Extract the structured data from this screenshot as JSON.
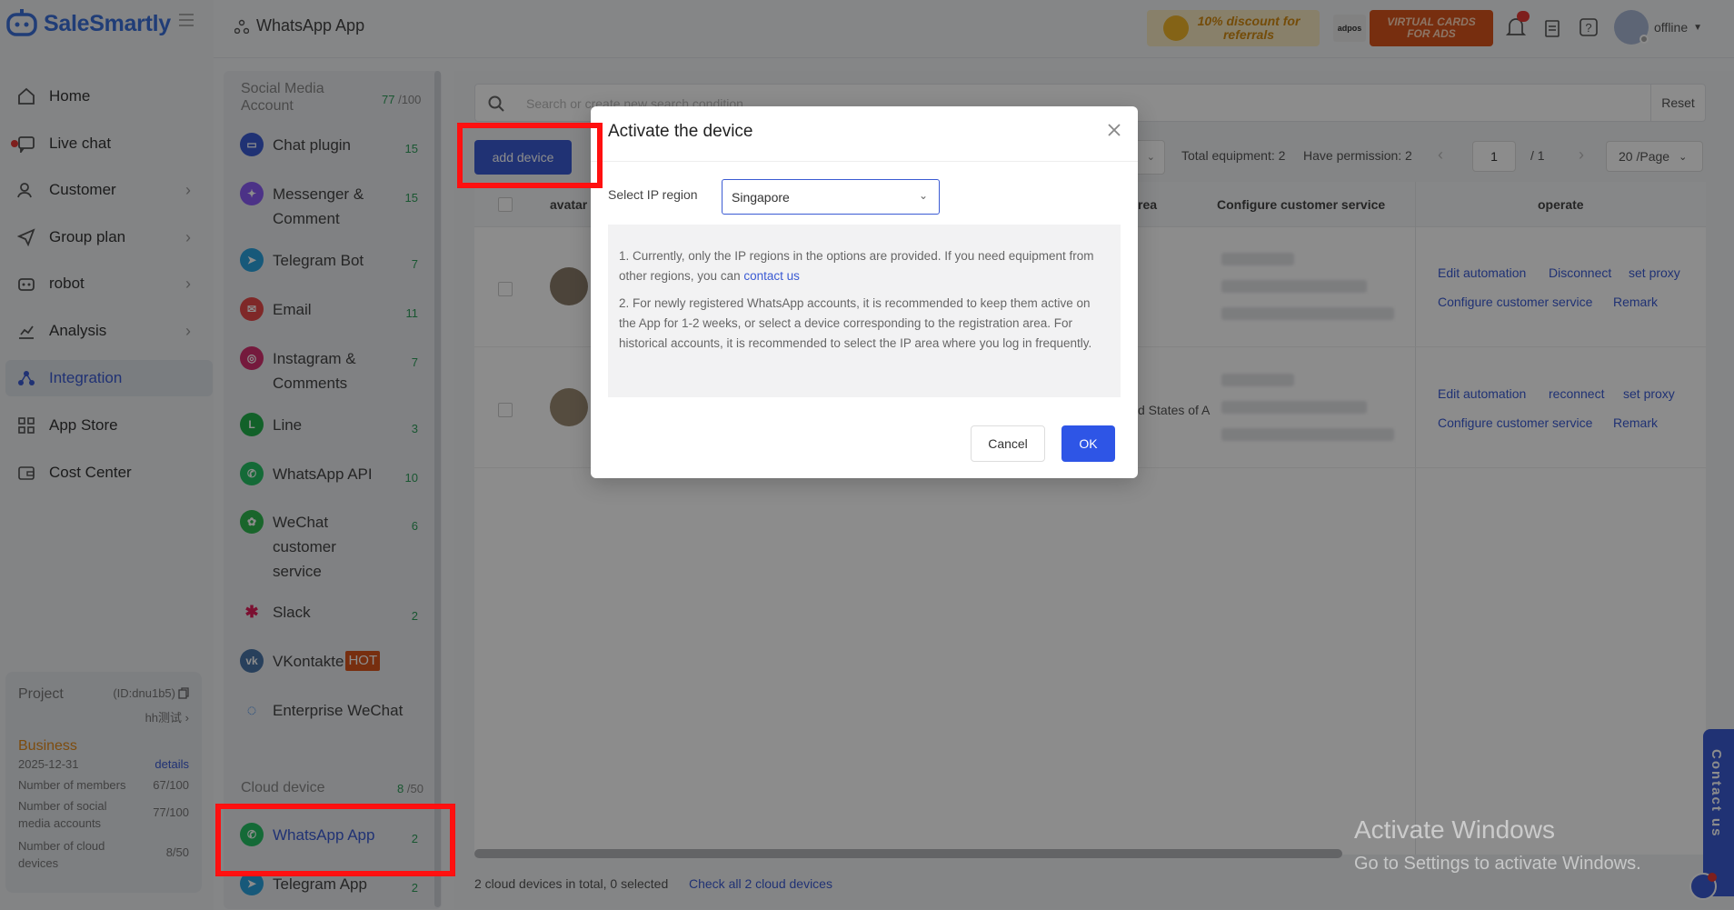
{
  "app": {
    "brand": "SaleSmartly",
    "brand_color": "#3b5bd3"
  },
  "nav": {
    "items": [
      {
        "label": "Home",
        "icon": "home-icon"
      },
      {
        "label": "Live chat",
        "icon": "chat-icon"
      },
      {
        "label": "Customer",
        "icon": "users-icon"
      },
      {
        "label": "Group plan",
        "icon": "send-icon"
      },
      {
        "label": "robot",
        "icon": "robot-icon"
      },
      {
        "label": "Analysis",
        "icon": "chart-icon"
      },
      {
        "label": "Integration",
        "icon": "integration-icon"
      },
      {
        "label": "App Store",
        "icon": "grid-icon"
      },
      {
        "label": "Cost Center",
        "icon": "wallet-icon"
      }
    ],
    "active": "Integration"
  },
  "project": {
    "label": "Project",
    "id": "(ID:dnu1b5)",
    "name": "hh测试",
    "plan": "Business",
    "expiry": "2025-12-31",
    "details_link": "details",
    "members_label": "Number of members",
    "members_value": "67/100",
    "social_label": "Number of social media accounts",
    "social_value": "77/100",
    "cloud_label": "Number of cloud devices",
    "cloud_value": "8/50"
  },
  "header": {
    "breadcrumb": "WhatsApp App",
    "promo1": "10% discount for referrals",
    "promo2_brand": "adpos",
    "promo3": "VIRTUAL CARDS FOR ADS",
    "status": "offline"
  },
  "side2": {
    "social_title": "Social Media Account",
    "social_count": "77",
    "social_total": "/100",
    "channels": [
      {
        "label": "Chat plugin",
        "count": "15",
        "color": "#3b5bd3"
      },
      {
        "label": "Messenger & Comment",
        "count": "15",
        "color": "#8b5cf6"
      },
      {
        "label": "Telegram Bot",
        "count": "7",
        "color": "#2aa3df"
      },
      {
        "label": "Email",
        "count": "11",
        "color": "#e84a4a"
      },
      {
        "label": "Instagram & Comments",
        "count": "7",
        "color": "#d6306f"
      },
      {
        "label": "Line",
        "count": "3",
        "color": "#22b14c"
      },
      {
        "label": "WhatsApp API",
        "count": "10",
        "color": "#25c264"
      },
      {
        "label": "WeChat customer service",
        "count": "6",
        "color": "#2fb84f"
      },
      {
        "label": "Slack",
        "count": "2",
        "color": "#e01e5a"
      },
      {
        "label": "VKontakte",
        "badge": "HOT",
        "color": "#4a76a8"
      },
      {
        "label": "Enterprise WeChat",
        "color": "#2a7ee8"
      }
    ],
    "cloud_title": "Cloud device",
    "cloud_count": "8",
    "cloud_total": "/50",
    "cloud_items": [
      {
        "label": "WhatsApp App",
        "count": "2",
        "color": "#25c264"
      },
      {
        "label": "Telegram App",
        "count": "2",
        "color": "#2aa3df"
      }
    ]
  },
  "main": {
    "search_placeholder": "Search or create new search condition",
    "reset": "Reset",
    "add_device": "add device",
    "total_equipment": "Total equipment: 2",
    "have_permission": "Have permission: 2",
    "page_current": "1",
    "page_total": "/ 1",
    "page_size": "20 /Page",
    "columns": {
      "avatar": "avatar",
      "area": "rea",
      "configure": "Configure customer service",
      "operate": "operate"
    },
    "rows": [
      {
        "area": "",
        "actions": [
          "Edit automation",
          "Disconnect",
          "set proxy",
          "Configure customer service",
          "Remark"
        ]
      },
      {
        "area": "d States of A",
        "actions": [
          "Edit automation",
          "reconnect",
          "set proxy",
          "Configure customer service",
          "Remark"
        ]
      }
    ],
    "footer_text": "2 cloud devices in total, 0 selected",
    "footer_link": "Check all 2 cloud devices"
  },
  "contact_float": "Contact us",
  "watermark": {
    "line1": "Activate Windows",
    "line2": "Go to Settings to activate Windows."
  },
  "modal": {
    "title": "Activate the device",
    "ip_label": "Select IP region",
    "ip_value": "Singapore",
    "note1_pre": "1. Currently, only the IP regions in the options are provided. If you need equipment from other regions, you can ",
    "note1_link": "contact us",
    "note2": "2. For newly registered WhatsApp accounts, it is recommended to keep them active on the App for 1-2 weeks, or select a device corresponding to the registration area. For historical accounts, it is recommended to select the IP area where you log in frequently.",
    "cancel": "Cancel",
    "ok": "OK"
  }
}
